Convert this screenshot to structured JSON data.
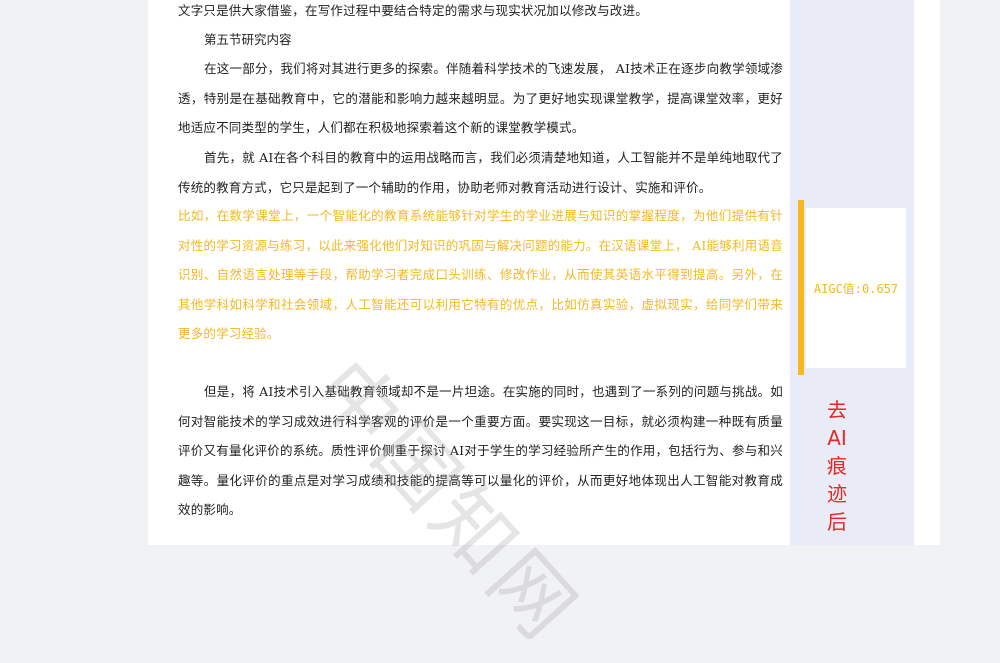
{
  "document": {
    "line_top": "文字只是供大家借鉴，在写作过程中要结合特定的需求与现实状况加以修改与改进。",
    "section_heading": "第五节研究内容",
    "paragraph_1": "在这一部分，我们将对其进行更多的探索。伴随着科学技术的飞速发展， AI技术正在逐步向教学领域渗透，特别是在基础教育中，它的潜能和影响力越来越明显。为了更好地实现课堂教学，提高课堂效率，更好地适应不同类型的学生，人们都在积极地探索着这个新的课堂教学模式。",
    "paragraph_2": "首先，就 AI在各个科目的教育中的运用战略而言，我们必须清楚地知道，人工智能并不是单纯地取代了传统的教育方式，它只是起到了一个辅助的作用，协助老师对教育活动进行设计、实施和评价。",
    "paragraph_highlight": "比如，在数学课堂上，一个智能化的教育系统能够针对学生的学业进展与知识的掌握程度，为他们提供有针对性的学习资源与练习，以此来强化他们对知识的巩固与解决问题的能力。在汉语课堂上， AI能够利用语音识别、自然语言处理等手段，帮助学习者完成口头训练、修改作业，从而使其英语水平得到提高。另外，在其他学科如科学和社会领域，人工智能还可以利用它特有的优点，比如仿真实验，虚拟现实，给同学们带来更多的学习经验。",
    "paragraph_3": "但是，将 AI技术引入基础教育领域却不是一片坦途。在实施的同时，也遇到了一系列的问题与挑战。如何对智能技术的学习成效进行科学客观的评价是一个重要方面。要实现这一目标，就必须构建一种既有质量评价又有量化评价的系统。质性评价侧重于探讨 AI对于学生的学习经验所产生的作用，包括行为、参与和兴趣等。量化评价的重点是对学习成绩和技能的提高等可以量化的评价，从而更好地体现出人工智能对教育成效的影响。"
  },
  "sidebar": {
    "aigc_value_label": "AIGC值:0.657",
    "remove_ai_button": "去AI痕迹后"
  },
  "watermark": "中国知网",
  "colors": {
    "highlight": "#f4b820",
    "button_red": "#e22a26",
    "panel_bg": "#e9ebf6"
  }
}
